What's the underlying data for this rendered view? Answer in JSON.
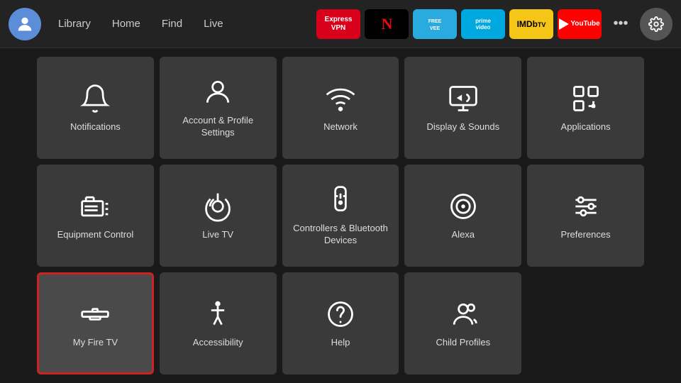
{
  "nav": {
    "links": [
      "Library",
      "Home",
      "Find",
      "Live"
    ],
    "apps": [
      {
        "id": "expressvpn",
        "label": "ExpressVPN",
        "style": "expressvpn"
      },
      {
        "id": "netflix",
        "label": "NETFLIX",
        "style": "netflix"
      },
      {
        "id": "freevee",
        "label": "Freevee",
        "style": "freevee"
      },
      {
        "id": "prime",
        "label": "prime video",
        "style": "prime"
      },
      {
        "id": "imdb",
        "label": "IMDbTV",
        "style": "imdb"
      },
      {
        "id": "youtube",
        "label": "YouTube",
        "style": "youtube"
      }
    ],
    "more_label": "...",
    "settings_icon": "gear"
  },
  "grid": {
    "items": [
      {
        "id": "notifications",
        "label": "Notifications",
        "icon": "bell",
        "focused": false
      },
      {
        "id": "account-profile",
        "label": "Account & Profile Settings",
        "icon": "person-circle",
        "focused": false
      },
      {
        "id": "network",
        "label": "Network",
        "icon": "wifi",
        "focused": false
      },
      {
        "id": "display-sounds",
        "label": "Display & Sounds",
        "icon": "display-sound",
        "focused": false
      },
      {
        "id": "applications",
        "label": "Applications",
        "icon": "apps",
        "focused": false
      },
      {
        "id": "equipment-control",
        "label": "Equipment Control",
        "icon": "tv-remote",
        "focused": false
      },
      {
        "id": "live-tv",
        "label": "Live TV",
        "icon": "antenna",
        "focused": false
      },
      {
        "id": "controllers-bluetooth",
        "label": "Controllers & Bluetooth Devices",
        "icon": "remote",
        "focused": false
      },
      {
        "id": "alexa",
        "label": "Alexa",
        "icon": "alexa",
        "focused": false
      },
      {
        "id": "preferences",
        "label": "Preferences",
        "icon": "sliders",
        "focused": false
      },
      {
        "id": "my-fire-tv",
        "label": "My Fire TV",
        "icon": "fire-tv",
        "focused": true
      },
      {
        "id": "accessibility",
        "label": "Accessibility",
        "icon": "accessibility",
        "focused": false
      },
      {
        "id": "help",
        "label": "Help",
        "icon": "help",
        "focused": false
      },
      {
        "id": "child-profiles",
        "label": "Child Profiles",
        "icon": "child",
        "focused": false
      }
    ]
  }
}
